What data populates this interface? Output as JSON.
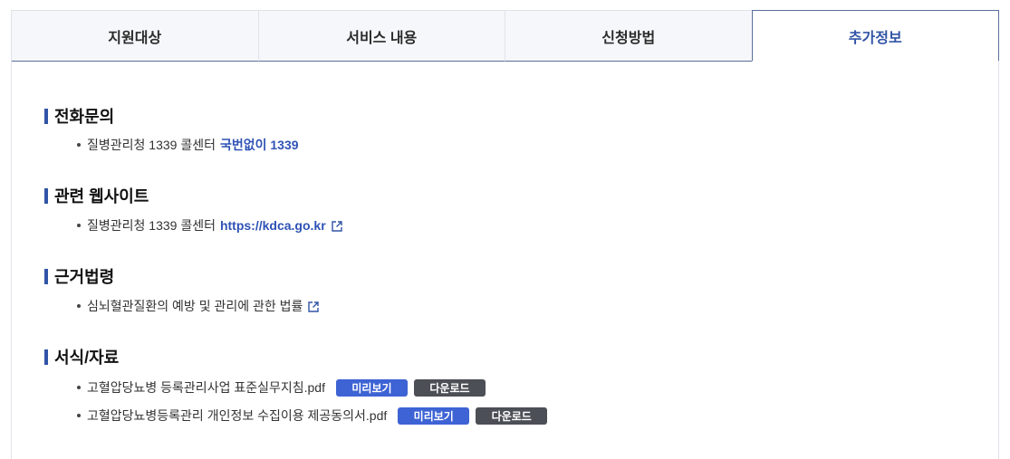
{
  "tabs": [
    {
      "label": "지원대상",
      "active": false
    },
    {
      "label": "서비스 내용",
      "active": false
    },
    {
      "label": "신청방법",
      "active": false
    },
    {
      "label": "추가정보",
      "active": true
    }
  ],
  "sections": {
    "phone": {
      "title": "전화문의",
      "item_text": "질병관리청 1339 콜센터",
      "item_highlight": "국번없이 1339"
    },
    "website": {
      "title": "관련 웹사이트",
      "item_text": "질병관리청 1339 콜센터",
      "item_link": "https://kdca.go.kr"
    },
    "law": {
      "title": "근거법령",
      "item_text": "심뇌혈관질환의 예방 및 관리에 관한 법률"
    },
    "forms": {
      "title": "서식/자료",
      "files": [
        {
          "name": "고혈압당뇨병 등록관리사업 표준실무지침.pdf",
          "preview_label": "미리보기",
          "download_label": "다운로드"
        },
        {
          "name": "고혈압당뇨병등록관리 개인정보 수집이용 제공동의서.pdf",
          "preview_label": "미리보기",
          "download_label": "다운로드"
        }
      ]
    }
  },
  "colors": {
    "accent": "#3154a6",
    "preview_button": "#3d63d4",
    "download_button": "#4d4f57"
  }
}
